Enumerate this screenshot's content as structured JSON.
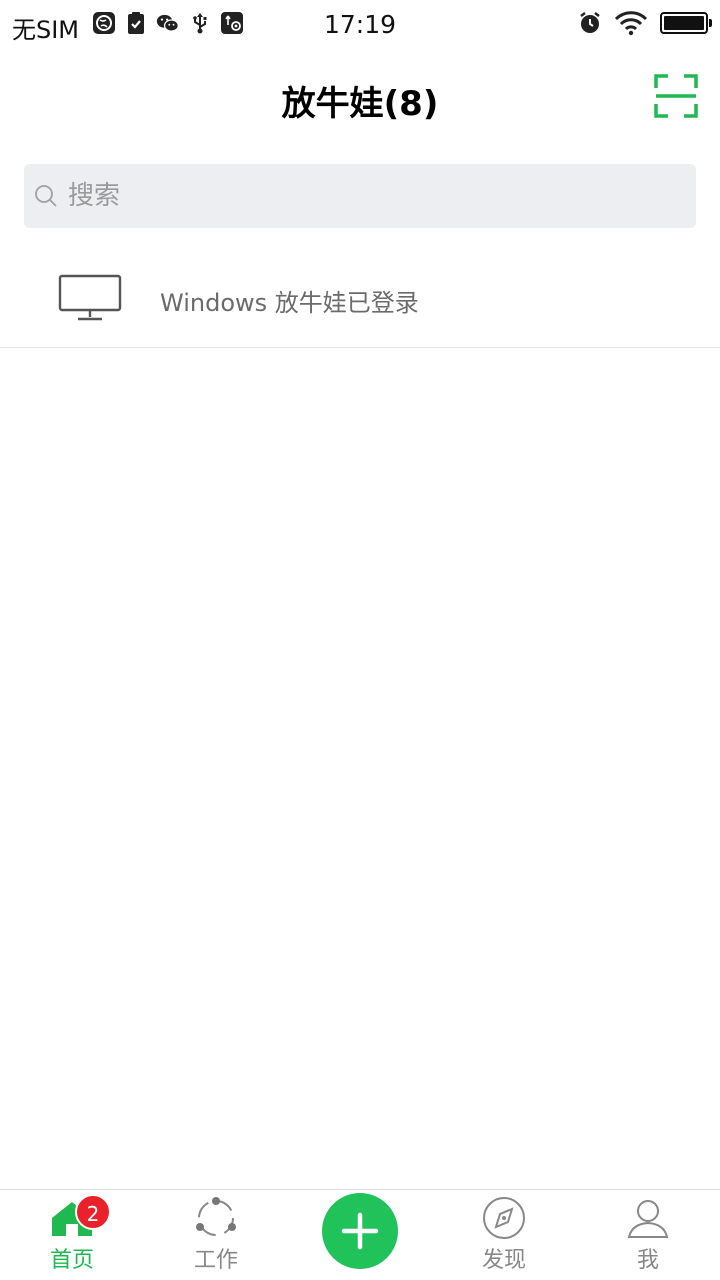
{
  "status_bar": {
    "carrier": "无SIM",
    "time": "17:19",
    "icons_left": [
      "globe-icon",
      "clipboard-check-icon",
      "wechat-icon",
      "usb-icon",
      "usb-debug-icon"
    ],
    "icons_right": [
      "alarm-icon",
      "wifi-icon",
      "battery-icon"
    ],
    "battery_level": 1.0
  },
  "header": {
    "title": "放牛娃(8)",
    "scan_icon": "scan-icon",
    "accent": "#1fb94f"
  },
  "search": {
    "placeholder": "搜索",
    "value": ""
  },
  "devices": [
    {
      "icon": "monitor-icon",
      "text": "Windows 放牛娃已登录"
    }
  ],
  "tab_bar": {
    "tabs": [
      {
        "label": "首页",
        "icon": "home-icon",
        "active": true,
        "badge": "2"
      },
      {
        "label": "工作",
        "icon": "work-icon",
        "active": false
      },
      {
        "label": "",
        "icon": "plus-icon",
        "active": false
      },
      {
        "label": "发现",
        "icon": "compass-icon",
        "active": false
      },
      {
        "label": "我",
        "icon": "person-icon",
        "active": false
      }
    ],
    "active_color": "#1fb94f",
    "badge_color": "#e8212a"
  }
}
